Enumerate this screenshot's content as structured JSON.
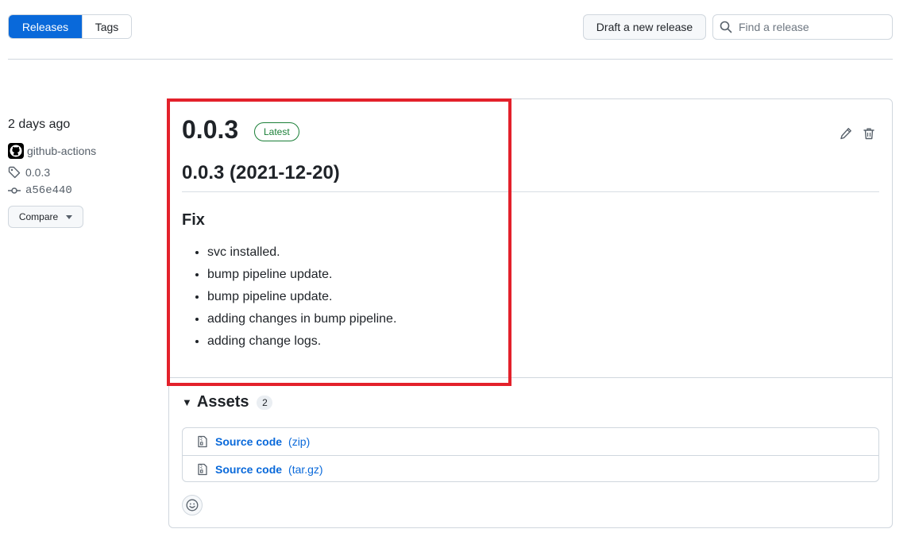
{
  "tabs": {
    "releases": "Releases",
    "tags": "Tags"
  },
  "toolbar": {
    "draft_label": "Draft a new release",
    "search_placeholder": "Find a release"
  },
  "meta": {
    "date": "2 days ago",
    "author": "github-actions",
    "tag": "0.0.3",
    "commit": "a56e440",
    "compare_label": "Compare"
  },
  "release": {
    "title": "0.0.3",
    "badge": "Latest",
    "subtitle": "0.0.3 (2021-12-20)",
    "section": "Fix",
    "notes": [
      "svc installed.",
      "bump pipeline update.",
      "bump pipeline update.",
      "adding changes in bump pipeline.",
      "adding change logs."
    ]
  },
  "assets": {
    "heading": "Assets",
    "count": "2",
    "items": [
      {
        "name": "Source code",
        "ext": "(zip)"
      },
      {
        "name": "Source code",
        "ext": "(tar.gz)"
      }
    ]
  },
  "colors": {
    "accent": "#0969da",
    "success": "#1a7f37",
    "highlight": "#e3212b"
  }
}
